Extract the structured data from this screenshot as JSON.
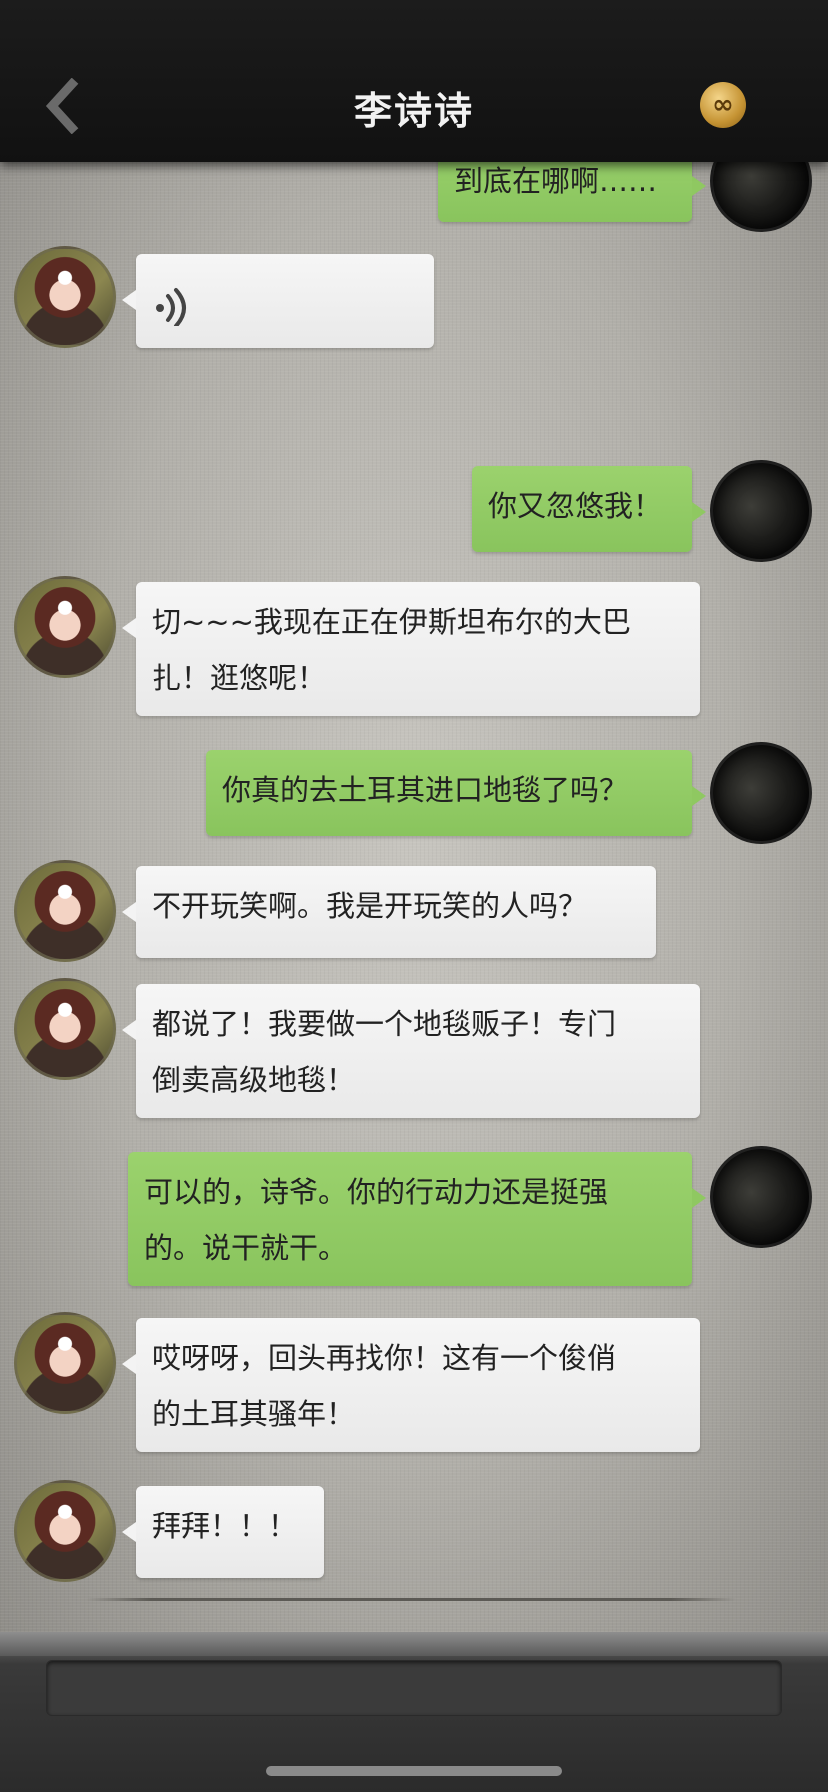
{
  "header": {
    "title": "李诗诗",
    "back_icon": "chevron-left-icon",
    "right_icon": "infinity-badge-icon",
    "right_icon_glyph": "∞"
  },
  "messages": [
    {
      "sender": "me",
      "type": "text",
      "text": "到底在哪啊……"
    },
    {
      "sender": "her",
      "type": "voice",
      "icon": "voice-wave-icon"
    },
    {
      "sender": "me",
      "type": "text",
      "text": "你又忽悠我！"
    },
    {
      "sender": "her",
      "type": "text",
      "lines": [
        "切~~~我现在正在伊斯坦布尔的大巴",
        "扎！逛悠呢！"
      ]
    },
    {
      "sender": "me",
      "type": "text",
      "text": "你真的去土耳其进口地毯了吗？"
    },
    {
      "sender": "her",
      "type": "text",
      "text": "不开玩笑啊。我是开玩笑的人吗？"
    },
    {
      "sender": "her",
      "type": "text",
      "lines": [
        "都说了！我要做一个地毯贩子！专门",
        "倒卖高级地毯！"
      ]
    },
    {
      "sender": "me",
      "type": "text",
      "lines": [
        "可以的，诗爷。你的行动力还是挺强",
        "的。说干就干。"
      ]
    },
    {
      "sender": "her",
      "type": "text",
      "lines": [
        "哎呀呀，回头再找你！这有一个俊俏",
        "的土耳其骚年！"
      ]
    },
    {
      "sender": "her",
      "type": "text",
      "text": "拜拜！！！"
    }
  ],
  "input": {
    "placeholder": ""
  },
  "colors": {
    "me_bubble": "#8fc861",
    "her_bubble": "#f3f3f3",
    "header": "#141414"
  }
}
